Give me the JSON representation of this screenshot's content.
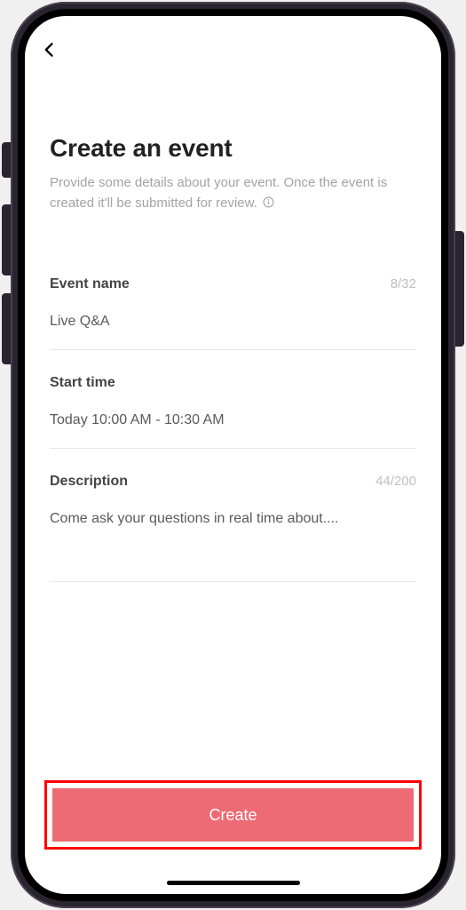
{
  "page": {
    "title": "Create an event",
    "subtitle": "Provide some details about your event. Once the event is created it'll be submitted for review."
  },
  "fields": {
    "event_name": {
      "label": "Event name",
      "value": "Live Q&A",
      "counter": "8/32"
    },
    "start_time": {
      "label": "Start time",
      "value": "Today 10:00 AM - 10:30 AM"
    },
    "description": {
      "label": "Description",
      "value": "Come ask your questions in real time about....",
      "counter": "44/200"
    }
  },
  "footer": {
    "create_label": "Create"
  }
}
